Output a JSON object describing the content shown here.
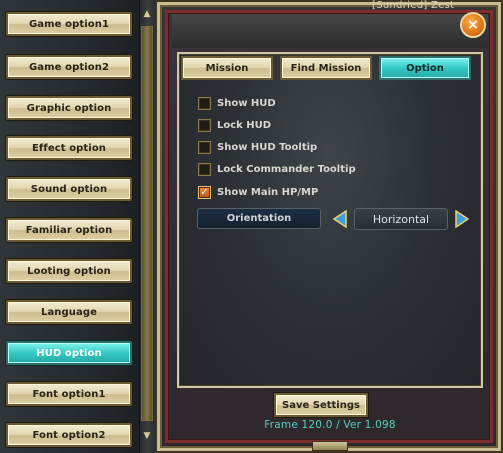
{
  "top_name": "[Sundried] Zest",
  "left_menu": {
    "items": [
      {
        "label": "Game option1",
        "active": false
      },
      {
        "label": "Game option2",
        "active": false
      },
      {
        "label": "Graphic option",
        "active": false
      },
      {
        "label": "Effect option",
        "active": false
      },
      {
        "label": "Sound option",
        "active": false
      },
      {
        "label": "Familiar option",
        "active": false
      },
      {
        "label": "Looting option",
        "active": false
      },
      {
        "label": "Language",
        "active": false
      },
      {
        "label": "HUD option",
        "active": true
      },
      {
        "label": "Font option1",
        "active": false
      },
      {
        "label": "Font option2",
        "active": false
      }
    ]
  },
  "window": {
    "close_label": "×",
    "tabs": [
      {
        "label": "Mission",
        "active": false
      },
      {
        "label": "Find Mission",
        "active": false
      },
      {
        "label": "Option",
        "active": true
      }
    ],
    "options": [
      {
        "label": "Show HUD",
        "checked": false
      },
      {
        "label": "Lock HUD",
        "checked": false
      },
      {
        "label": "Show HUD Tooltip",
        "checked": false
      },
      {
        "label": "Lock Commander Tooltip",
        "checked": false
      },
      {
        "label": "Show Main HP/MP",
        "checked": true
      }
    ],
    "orientation": {
      "label": "Orientation",
      "value": "Horizontal"
    },
    "save_label": "Save Settings",
    "version_text": "Frame 120.0 / Ver 1.098"
  },
  "colors": {
    "active_tab": "#35c9c3",
    "button_face": "#e2d6b0",
    "version_text": "#4fd2c2",
    "check_mark": "#f08a3a"
  }
}
